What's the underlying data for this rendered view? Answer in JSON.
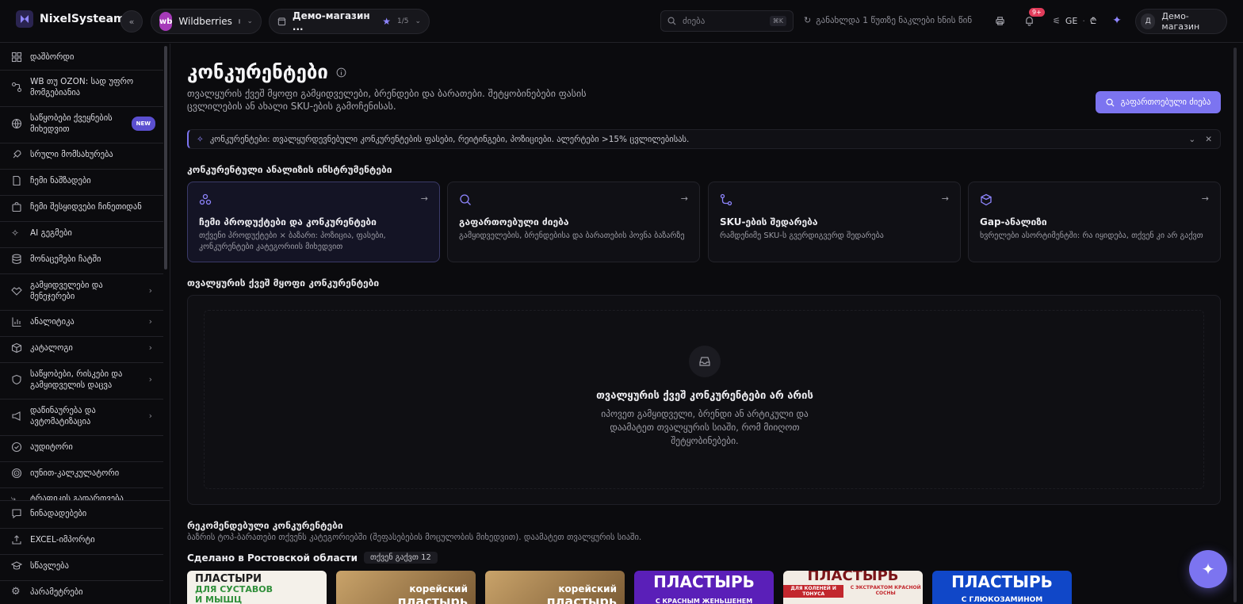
{
  "header": {
    "app_name": "NixelSysteam",
    "marketplace": {
      "name": "Wildberries",
      "badge": "wb"
    },
    "store": {
      "name": "Демо-магазин ...",
      "counter": "1/5"
    },
    "search": {
      "placeholder": "ძიება",
      "shortcut": "⌘K"
    },
    "updated_text": "განახლდა 1 წუთზე ნაკლები ხნის წინ",
    "notifications_badge": "9+",
    "language": "GE",
    "currency": "₾",
    "user": {
      "initial": "Д",
      "store": "Демо-магазин"
    }
  },
  "sidebar": {
    "items": [
      {
        "label": "დაშბორდი",
        "icon": "dashboard-icon"
      },
      {
        "label": "WB თუ OZON: სად უფრო მომგებიანია",
        "icon": "compare-icon"
      },
      {
        "label": "საწყობები ქვეყნების მიხედვით",
        "icon": "globe-icon",
        "badge": "NEW"
      },
      {
        "label": "სრული მომსახურება",
        "icon": "rocket-icon"
      },
      {
        "label": "ჩემი ნაშზადები",
        "icon": "file-icon"
      },
      {
        "label": "ჩემი შესყიდვები ჩინეთიდან",
        "icon": "bag-icon"
      },
      {
        "label": "AI გეგმები",
        "icon": "sparkle-icon"
      },
      {
        "label": "მონაცემები ჩატში",
        "icon": "database-icon"
      },
      {
        "label": "გამყიდველები და მენეჯერები",
        "icon": "handshake-icon"
      },
      {
        "label": "ანალიტიკა",
        "icon": "chart-icon"
      },
      {
        "label": "კატალოგი",
        "icon": "box-icon"
      },
      {
        "label": "საწყობები, რისკები და გამყიდველის დაცვა",
        "icon": "shield-icon"
      },
      {
        "label": "დაწინაურება და ავტომატიზაცია",
        "icon": "megaphone-icon"
      },
      {
        "label": "აუდიტორი",
        "icon": "check-circle-icon"
      },
      {
        "label": "იუნით-კალკულატორი",
        "icon": "target-icon"
      },
      {
        "label": "ტრაფიკის გადართვება",
        "icon": "traffic-icon"
      }
    ],
    "footer": [
      {
        "label": "ნინადადებები",
        "icon": "message-icon"
      },
      {
        "label": "EXCEL-იმპორტი",
        "icon": "upload-icon"
      },
      {
        "label": "სწავლება",
        "icon": "graduation-icon"
      },
      {
        "label": "პარამეტრები",
        "icon": "gear-icon"
      }
    ]
  },
  "main": {
    "title": "კონკურენტები",
    "subtitle": "თვალყურის ქვეშ მყოფი გამყიდველები, ბრენდები და ბარათები. შეტყობინებები ფასის ცვლილების ან ახალი SKU-ების გამოჩენისას.",
    "advanced_search_button": "გაფართოებული ძიება",
    "banner": "კონკურენტები: თვალყურდევნებული კონკურენტების ფასები, რეიტინგები, პოზიციები. ალერტები >15% ცვლილებისას.",
    "tools_title": "კონკურენტული ანალიზის ინსტრუმენტები",
    "tools": [
      {
        "name": "ჩემი პროდუქტები და კონკურენტები",
        "desc": "თქვენი პროდუქტები × ბაზარი: პოზიცია, ფასები, კონკურენტები კატეგორიის მიხედვით",
        "icon": "network-icon"
      },
      {
        "name": "გაფართოებული ძიება",
        "desc": "გამყიდველების, ბრენდებისა და ბარათების პოვნა ბაზარზე",
        "icon": "search-icon"
      },
      {
        "name": "SKU-ების შედარება",
        "desc": "რამდენიმე SKU-ს გვერდიგვერდ შედარება",
        "icon": "route-icon"
      },
      {
        "name": "Gap-ანალიზი",
        "desc": "ხვრელები ასორტიმენტში: რა იყიდება, თქვენ კი არ გაქვთ",
        "icon": "package-search-icon"
      }
    ],
    "tracked_title": "თვალყურის ქვეშ მყოფი კონკურენტები",
    "empty_title": "თვალყურის ქვეშ კონკურენტები არ არის",
    "empty_desc": "იპოვეთ გამყიდველი, ბრენდი ან არტიკული და დაამატეთ თვალყურის სიაში, რომ მიიღოთ შეტყობინებები.",
    "rec_title": "რეკომენდებული კონკურენტები",
    "rec_desc": "ბაზრის ტოპ-ბარათები თქვენს კატეგორიებში (შეფასებების მოცულობის მიხედვით). დაამატეთ თვალყურის სიაში.",
    "region_title": "Сделано в Ростовской области",
    "region_count": "თქვენ გაქვთ 12",
    "products": [
      {
        "line1": "ПЛАСТЫРИ",
        "line2": "ДЛЯ СУСТАВОВ",
        "line3": "И МЫШЦ"
      },
      {
        "line1": "корейский",
        "line2": "пластырь"
      },
      {
        "line1": "корейский",
        "line2": "пластырь"
      },
      {
        "line1": "ПЛАСТЫРЬ",
        "line2": "С КРАСНЫМ ЖЕНЬШЕНЕМ"
      },
      {
        "line1": "ПЛАСТЫРЬ",
        "line2": "ДЛЯ КОЛЕНЕЙ И ТОНУСА",
        "line3": "С ЭКСТРАКТОМ КРАСНОЙ СОСНЫ"
      },
      {
        "line1": "ПЛАСТЫРЬ",
        "line2": "С ГЛЮКОЗАМИНОМ"
      }
    ]
  },
  "colors": {
    "accent": "#7c74f0",
    "bg": "#0b0b0e",
    "danger": "#e03c5a"
  }
}
